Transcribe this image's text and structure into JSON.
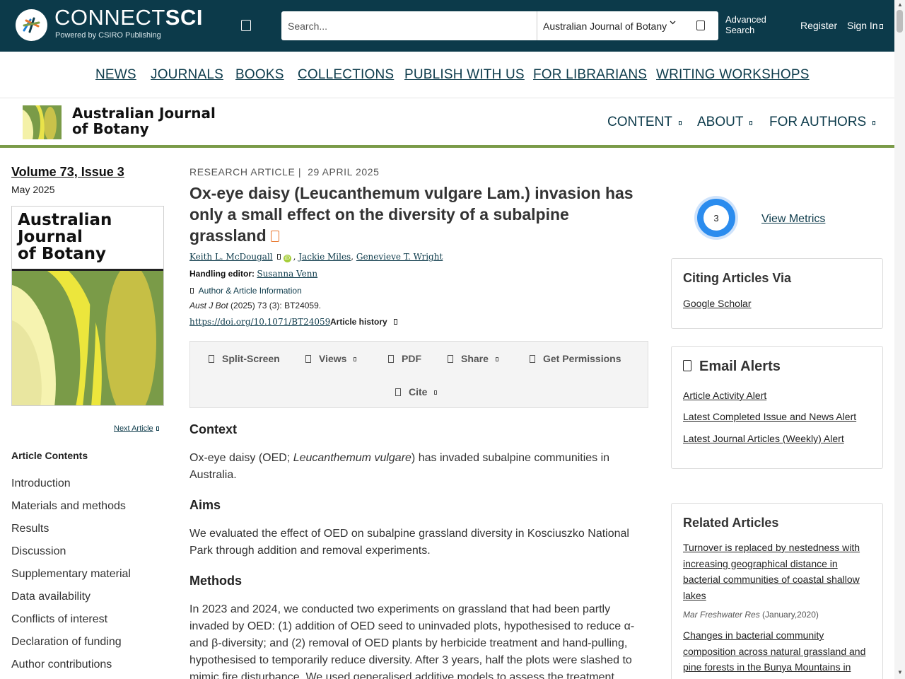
{
  "header": {
    "brand_light": "CONNECT",
    "brand_bold": "SCI",
    "tagline": "Powered by CSIRO Publishing",
    "search_placeholder": "Search...",
    "search_scope": "Australian Journal of Botany",
    "advanced_search": "Advanced Search",
    "register": "Register",
    "sign_in": "Sign In"
  },
  "main_nav": [
    "NEWS",
    "JOURNALS",
    "BOOKS",
    "COLLECTIONS",
    "PUBLISH WITH US",
    "FOR LIBRARIANS",
    "WRITING WORKSHOPS"
  ],
  "journal": {
    "title_line1": "Australian Journal",
    "title_line2": "of Botany",
    "nav": [
      "CONTENT",
      "ABOUT",
      "FOR AUTHORS"
    ]
  },
  "sidebar": {
    "issue": "Volume 73, Issue 3",
    "issue_date": "May 2025",
    "cover_title": [
      "Australian",
      "Journal",
      "of Botany"
    ],
    "next_article": "Next Article",
    "contents_heading": "Article Contents",
    "contents": [
      "Introduction",
      "Materials and methods",
      "Results",
      "Discussion",
      "Supplementary material",
      "Data availability",
      "Conflicts of interest",
      "Declaration of funding",
      "Author contributions"
    ]
  },
  "article": {
    "type": "RESEARCH ARTICLE |",
    "date": "29 APRIL 2025",
    "title": "Ox-eye daisy (Leucanthemum vulgare Lam.) invasion has only a small effect on the diversity of a subalpine grassland",
    "authors": [
      "Keith L. McDougall",
      "Jackie Miles",
      "Genevieve T. Wright"
    ],
    "handling_label": "Handling editor:",
    "handling_editor": "Susanna Venn",
    "author_info": "Author & Article Information",
    "citation_journal": "Aust J Bot",
    "citation_rest": " (2025) 73 (3): BT24059.",
    "doi": "https://doi.org/10.1071/BT24059",
    "history": "Article history",
    "tools": {
      "split_screen": "Split-Screen",
      "views": "Views",
      "pdf": "PDF",
      "share": "Share",
      "permissions": "Get Permissions",
      "cite": "Cite"
    },
    "context_head": "Context",
    "context_pre": "Ox-eye daisy (OED; ",
    "context_italic": "Leucanthemum vulgare",
    "context_post": ") has invaded subalpine communities in Australia.",
    "aims_head": "Aims",
    "aims_body": "We evaluated the effect of OED on subalpine grassland diversity in Kosciuszko National Park through addition and removal experiments.",
    "methods_head": "Methods",
    "methods_body": "In 2023 and 2024, we conducted two experiments on grassland that had been partly invaded by OED: (1) addition of OED seed to uninvaded plots, hypothesised to reduce α- and β-diversity; and (2) removal of OED plants by herbicide treatment and hand-pulling, hypothesised to temporarily reduce diversity. After 3 years, half the plots were slashed to mimic fire disturbance. We used generalised additive models to assess the treatment effects"
  },
  "right": {
    "altmetric_score": "3",
    "view_metrics": "View Metrics",
    "citing_title": "Citing Articles Via",
    "google_scholar": "Google Scholar",
    "alerts_title": "Email Alerts",
    "alerts": [
      "Article Activity Alert",
      "Latest Completed Issue and News Alert",
      "Latest Journal Articles (Weekly) Alert"
    ],
    "related_title": "Related Articles",
    "related": [
      {
        "title": "Turnover is replaced by nestedness with increasing geographical distance in bacterial communities of coastal shallow lakes",
        "journal": "Mar Freshwater Res",
        "date": " (January,2020)"
      },
      {
        "title": "Changes in bacterial community composition across natural grassland and pine forests in the Bunya Mountains in"
      }
    ]
  },
  "colors": {
    "header_bg": "#0c3a4a",
    "accent_olive": "#7a9b48",
    "open_access": "#e8762c",
    "altmetric_blue": "#2b8cee"
  }
}
